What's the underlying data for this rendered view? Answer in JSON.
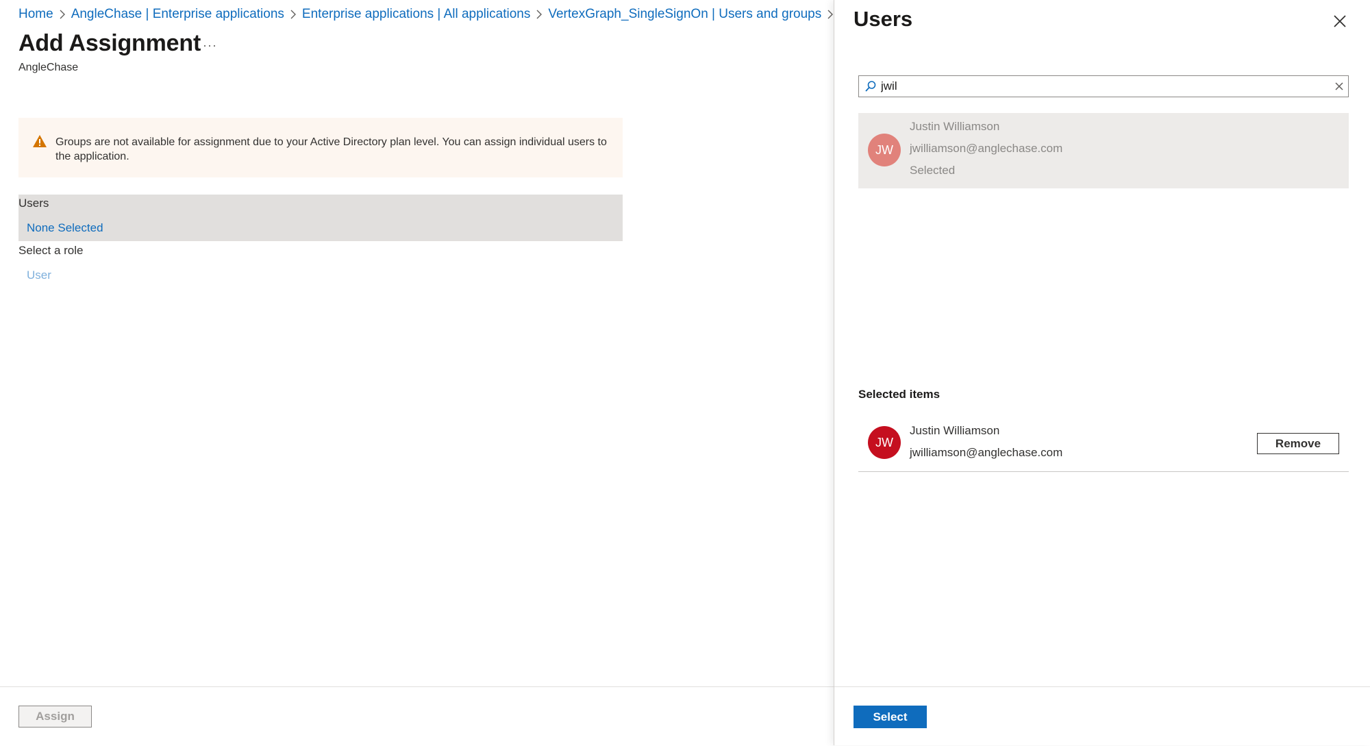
{
  "breadcrumb": [
    {
      "label": "Home"
    },
    {
      "label": "AngleChase | Enterprise applications"
    },
    {
      "label": "Enterprise applications | All applications"
    },
    {
      "label": "VertexGraph_SingleSignOn | Users and groups"
    }
  ],
  "page": {
    "title": "Add Assignment",
    "more_label": "···",
    "subtitle": "AngleChase"
  },
  "warning": {
    "icon": "warning-icon",
    "text": "Groups are not available for assignment due to your Active Directory plan level. You can assign individual users to the application."
  },
  "form": {
    "users_label": "Users",
    "users_value": "None Selected",
    "role_label": "Select a role",
    "role_value": "User"
  },
  "footer": {
    "assign_label": "Assign"
  },
  "panel": {
    "title": "Users",
    "search": {
      "value": "jwil"
    },
    "results": [
      {
        "initials": "JW",
        "name": "Justin Williamson",
        "email": "jwilliamson@anglechase.com",
        "status": "Selected",
        "avatar_color": "#e1827b"
      }
    ],
    "selected_heading": "Selected items",
    "selected": [
      {
        "initials": "JW",
        "name": "Justin Williamson",
        "email": "jwilliamson@anglechase.com",
        "remove_label": "Remove",
        "avatar_color": "#c50f1f"
      }
    ],
    "select_label": "Select"
  },
  "colors": {
    "accent": "#0f6cbd",
    "warning": "#d47500",
    "warning_bg": "#fdf6f0"
  }
}
